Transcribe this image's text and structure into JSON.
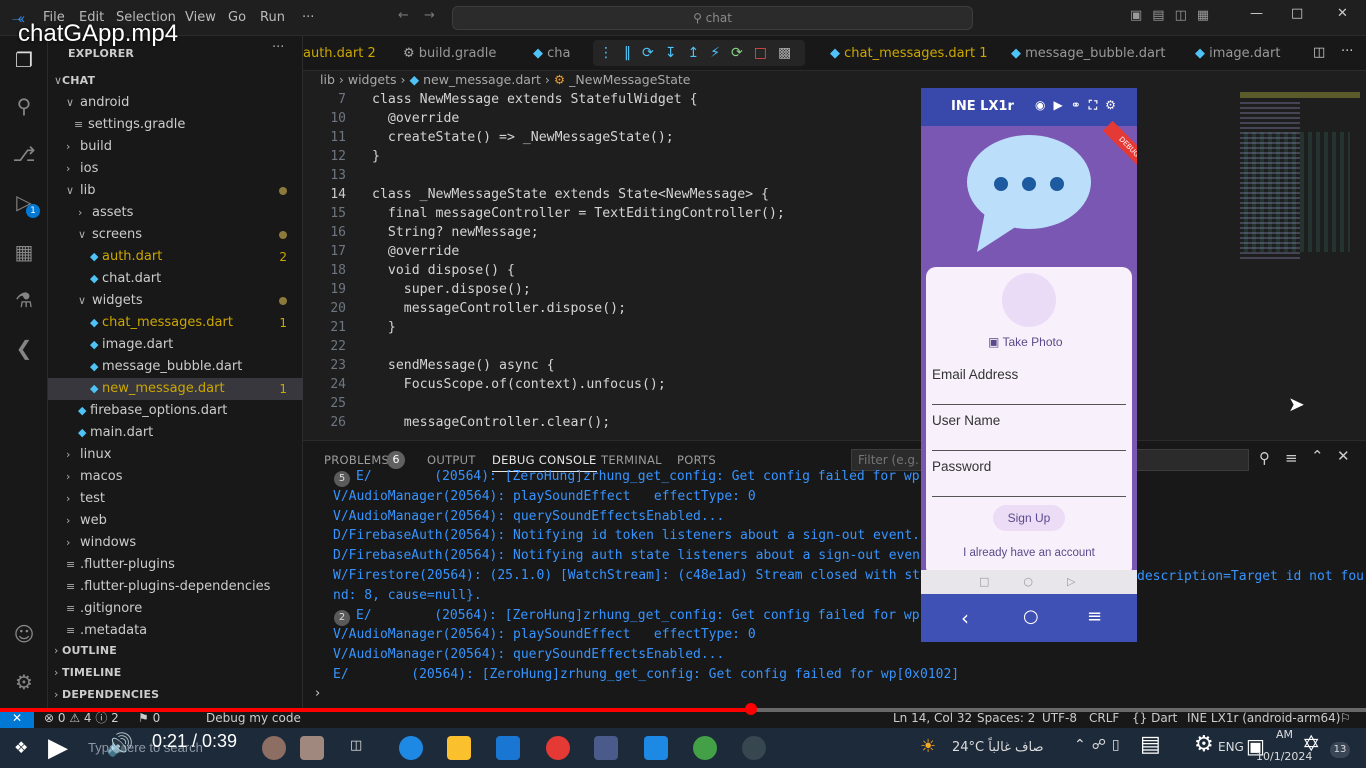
{
  "video": {
    "title": "chatGApp.mp4",
    "time": "0:21 / 0:39",
    "progress": 0.55
  },
  "titlebar": {
    "menus": [
      "File",
      "Edit",
      "Selection",
      "View",
      "Go",
      "Run",
      "···"
    ],
    "command_center": "chat"
  },
  "explorer": {
    "title": "EXPLORER",
    "root": "CHAT",
    "items": [
      {
        "label": "android",
        "kind": "folder-open"
      },
      {
        "label": "settings.gradle",
        "kind": "file"
      },
      {
        "label": "build",
        "kind": "folder"
      },
      {
        "label": "ios",
        "kind": "folder"
      },
      {
        "label": "lib",
        "kind": "folder-open"
      },
      {
        "label": "assets",
        "kind": "folder"
      },
      {
        "label": "screens",
        "kind": "folder-open"
      },
      {
        "label": "auth.dart",
        "kind": "dart",
        "badge": "2"
      },
      {
        "label": "chat.dart",
        "kind": "dart"
      },
      {
        "label": "widgets",
        "kind": "folder-open"
      },
      {
        "label": "chat_messages.dart",
        "kind": "dart",
        "badge": "1"
      },
      {
        "label": "image.dart",
        "kind": "dart"
      },
      {
        "label": "message_bubble.dart",
        "kind": "dart"
      },
      {
        "label": "new_message.dart",
        "kind": "dart",
        "badge": "1"
      },
      {
        "label": "firebase_options.dart",
        "kind": "dart"
      },
      {
        "label": "main.dart",
        "kind": "dart"
      },
      {
        "label": "linux",
        "kind": "folder"
      },
      {
        "label": "macos",
        "kind": "folder"
      },
      {
        "label": "test",
        "kind": "folder"
      },
      {
        "label": "web",
        "kind": "folder"
      },
      {
        "label": "windows",
        "kind": "folder"
      },
      {
        "label": ".flutter-plugins",
        "kind": "file"
      },
      {
        "label": ".flutter-plugins-dependencies",
        "kind": "file"
      },
      {
        "label": ".gitignore",
        "kind": "file"
      },
      {
        "label": ".metadata",
        "kind": "file"
      }
    ],
    "sections": [
      "OUTLINE",
      "TIMELINE",
      "DEPENDENCIES"
    ]
  },
  "tabs": [
    {
      "label": "auth.dart",
      "badge": "2"
    },
    {
      "label": "build.gradle"
    },
    {
      "label": "cha"
    },
    {
      "label": "chat_messages.dart",
      "badge": "1"
    },
    {
      "label": "message_bubble.dart"
    },
    {
      "label": "image.dart"
    }
  ],
  "breadcrumb": [
    "lib",
    "widgets",
    "new_message.dart",
    "_NewMessageState"
  ],
  "editor": {
    "lines": [
      {
        "n": "7",
        "t": "class NewMessage extends StatefulWidget {"
      },
      {
        "n": "10",
        "t": "  @override"
      },
      {
        "n": "11",
        "t": "  createState() => _NewMessageState();"
      },
      {
        "n": "12",
        "t": "}"
      },
      {
        "n": "13",
        "t": ""
      },
      {
        "n": "14",
        "t": "class _NewMessageState extends State<NewMessage> {"
      },
      {
        "n": "15",
        "t": "  final messageController = TextEditingController();"
      },
      {
        "n": "16",
        "t": "  String? newMessage;"
      },
      {
        "n": "17",
        "t": "  @override"
      },
      {
        "n": "18",
        "t": "  void dispose() {"
      },
      {
        "n": "19",
        "t": "    super.dispose();"
      },
      {
        "n": "20",
        "t": "    messageController.dispose();"
      },
      {
        "n": "21",
        "t": "  }"
      },
      {
        "n": "22",
        "t": ""
      },
      {
        "n": "23",
        "t": "  sendMessage() async {"
      },
      {
        "n": "24",
        "t": "    FocusScope.of(context).unfocus();"
      },
      {
        "n": "25",
        "t": ""
      },
      {
        "n": "26",
        "t": "    messageController.clear();"
      }
    ]
  },
  "panel": {
    "tabs": [
      "PROBLEMS",
      "OUTPUT",
      "DEBUG CONSOLE",
      "TERMINAL",
      "PORTS"
    ],
    "problems_count": "6",
    "filter_placeholder": "Filter (e.g. te",
    "logs": [
      {
        "badge": "5",
        "t": "E/        (20564): [ZeroHung]zrhung_get_config: Get config failed for wp[0"
      },
      {
        "t": "V/AudioManager(20564): playSoundEffect   effectType: 0"
      },
      {
        "t": "V/AudioManager(20564): querySoundEffectsEnabled..."
      },
      {
        "t": "D/FirebaseAuth(20564): Notifying id token listeners about a sign-out event."
      },
      {
        "t": "D/FirebaseAuth(20564): Notifying auth state listeners about a sign-out event"
      },
      {
        "t": "W/Firestore(20564): (25.1.0) [WatchStream]: (c48e1ad) Stream closed with sta"
      },
      {
        "t": "nd: 8, cause=null}."
      },
      {
        "badge": "2",
        "t": "E/        (20564): [ZeroHung]zrhung_get_config: Get config failed for wp[0"
      },
      {
        "t": "V/AudioManager(20564): playSoundEffect   effectType: 0"
      },
      {
        "t": "V/AudioManager(20564): querySoundEffectsEnabled..."
      },
      {
        "t": "E/        (20564): [ZeroHung]zrhung_get_config: Get config failed for wp[0x0102]"
      }
    ],
    "log_tail": "description=Target id not fou"
  },
  "phone": {
    "device": "INE LX1r",
    "debug_banner": "DEBUG",
    "take_photo": "Take Photo",
    "fields": [
      "Email Address",
      "User Name",
      "Password"
    ],
    "signup": "Sign Up",
    "have_account": "I already have an account"
  },
  "statusbar": {
    "left": [
      "⊗ 0 ⚠ 4 ⓘ 2",
      "⚑ 0",
      "Debug my code"
    ],
    "position": "Ln 14, Col 32",
    "spaces": "Spaces: 2",
    "encoding": "UTF-8",
    "eol": "CRLF",
    "language": "{} Dart",
    "device": "INE LX1r (android-arm64)"
  },
  "taskbar": {
    "search_placeholder": "Type here to search",
    "weather": "24°C  صاف غالباً",
    "lang": "ENG",
    "date": "10/1/2024",
    "clock": "AM",
    "notif": "13"
  },
  "colors": {
    "accent": "#3794ff",
    "progress": "#ff0000",
    "phone_primary": "#3f51b5",
    "phone_bg": "#7a57b3"
  }
}
